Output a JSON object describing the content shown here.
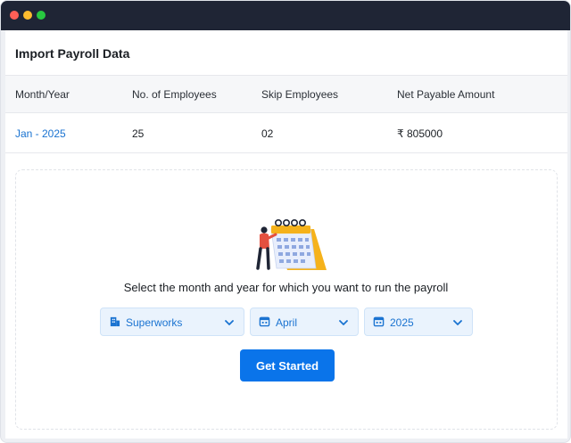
{
  "window": {
    "controls": [
      "close",
      "minimize",
      "maximize"
    ]
  },
  "header": {
    "title": "Import Payroll Data"
  },
  "table": {
    "columns": [
      "Month/Year",
      "No. of Employees",
      "Skip Employees",
      "Net Payable Amount"
    ],
    "rows": [
      {
        "month_year": "Jan - 2025",
        "employees": "25",
        "skip": "02",
        "net_payable": "₹ 805000"
      }
    ]
  },
  "import": {
    "illustration_icon": "calendar-person-illustration",
    "prompt": "Select the month and year for which you want to run the payroll",
    "selects": [
      {
        "icon": "building-icon",
        "value": "Superworks"
      },
      {
        "icon": "calendar-icon",
        "value": "April"
      },
      {
        "icon": "calendar-icon",
        "value": "2025"
      }
    ],
    "button_label": "Get Started"
  },
  "colors": {
    "accent": "#0a74ea",
    "link": "#1a73d1",
    "titlebar": "#1f2535",
    "select_bg": "#eaf3fd"
  }
}
